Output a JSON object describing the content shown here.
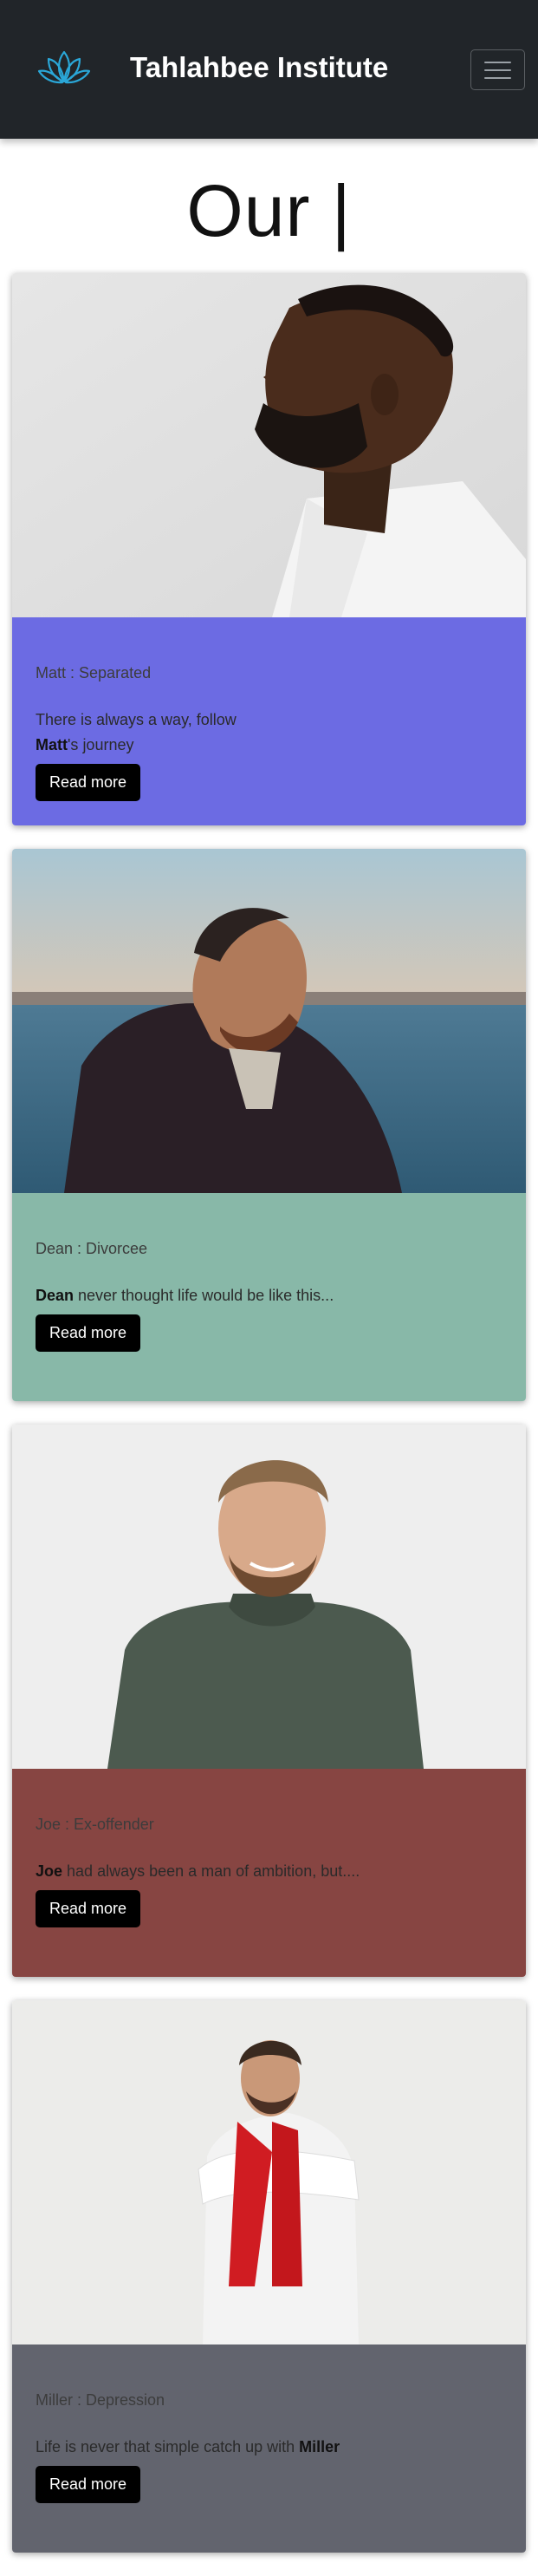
{
  "navbar": {
    "brand": "Tahlahbee Institute",
    "logo_icon": "lotus-icon",
    "toggler_icon": "hamburger-menu-icon"
  },
  "heading": "Our |",
  "colors": {
    "navbar_bg": "#212529",
    "card1": "#6c6be3",
    "card2": "#88b8a8",
    "card3": "#874542",
    "card4": "#62646e"
  },
  "cards": [
    {
      "name": "Matt",
      "category": "Separated",
      "text_pre": "There is always a way, follow ",
      "text_bold": "Matt",
      "text_post": "'s journey",
      "button": "Read more",
      "photo": "man-profile-photo"
    },
    {
      "name": "Dean",
      "category": "Divorcee",
      "text_bold": "Dean",
      "text_post": " never thought life would be like this...",
      "button": "Read more",
      "photo": "man-by-sea-photo"
    },
    {
      "name": "Joe",
      "category": "Ex-offender",
      "text_bold": "Joe",
      "text_post": " had always been a man of ambition, but....",
      "button": "Read more",
      "photo": "smiling-man-photo"
    },
    {
      "name": "Miller",
      "category": "Depression",
      "text_pre": "Life is never that simple catch up with ",
      "text_bold": "Miller",
      "button": "Read more",
      "photo": "man-hugging-self-photo"
    }
  ]
}
